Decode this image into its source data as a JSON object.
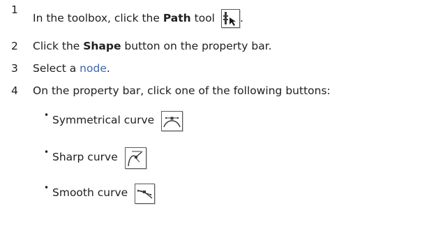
{
  "steps": [
    {
      "number": "1",
      "before": "In the toolbox, click the ",
      "bold": "Path",
      "after": " tool",
      "trailing": ".",
      "icon": "path-tool-icon"
    },
    {
      "number": "2",
      "before": "Click the ",
      "bold": "Shape",
      "after": " button on the property bar."
    },
    {
      "number": "3",
      "before": "Select a ",
      "link": "node",
      "after": "."
    },
    {
      "number": "4",
      "text": "On the property bar, click one of the following buttons:"
    }
  ],
  "bullets": [
    {
      "label": "Symmetrical curve",
      "icon": "symmetrical-curve-icon"
    },
    {
      "label": "Sharp curve",
      "icon": "sharp-curve-icon"
    },
    {
      "label": "Smooth curve",
      "icon": "smooth-curve-icon"
    }
  ],
  "colors": {
    "text": "#202020",
    "link": "#3a66b0",
    "icon_border": "#5a5a5a"
  }
}
